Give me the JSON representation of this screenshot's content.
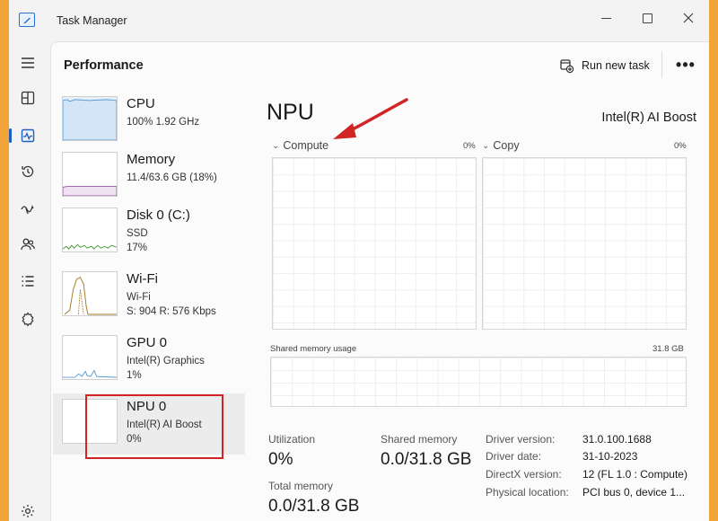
{
  "window": {
    "app_title": "Task Manager"
  },
  "nav": {
    "items": [
      {
        "name": "menu",
        "icon": "hamburger-icon"
      },
      {
        "name": "processes",
        "icon": "processes-icon"
      },
      {
        "name": "performance",
        "icon": "performance-icon",
        "active": true
      },
      {
        "name": "app-history",
        "icon": "history-icon"
      },
      {
        "name": "startup-apps",
        "icon": "startup-icon"
      },
      {
        "name": "users",
        "icon": "users-icon"
      },
      {
        "name": "details",
        "icon": "details-icon"
      },
      {
        "name": "services",
        "icon": "services-icon"
      },
      {
        "name": "settings",
        "icon": "gear-icon"
      }
    ],
    "accent": "#1b5fc5"
  },
  "header": {
    "title": "Performance",
    "run_new_task": "Run new task",
    "more": "•••"
  },
  "devices": [
    {
      "name": "CPU",
      "line2": "100%  1.92 GHz",
      "line3": ""
    },
    {
      "name": "Memory",
      "line2": "11.4/63.6 GB (18%)",
      "line3": ""
    },
    {
      "name": "Disk 0 (C:)",
      "line2": "SSD",
      "line3": "17%"
    },
    {
      "name": "Wi-Fi",
      "line2": "Wi-Fi",
      "line3": "S: 904  R: 576 Kbps"
    },
    {
      "name": "GPU 0",
      "line2": "Intel(R) Graphics",
      "line3": "1%"
    },
    {
      "name": "NPU 0",
      "line2": "Intel(R) AI Boost",
      "line3": "0%",
      "selected": true
    }
  ],
  "detail": {
    "title": "NPU",
    "subtitle": "Intel(R) AI Boost",
    "graphs": [
      {
        "label": "Compute",
        "pct": "0%"
      },
      {
        "label": "Copy",
        "pct": "0%"
      }
    ],
    "shared_memory_label": "Shared memory usage",
    "shared_memory_max": "31.8 GB",
    "stats": {
      "utilization_label": "Utilization",
      "utilization_value": "0%",
      "shared_memory_label": "Shared memory",
      "shared_memory_value": "0.0/31.8 GB",
      "total_memory_label": "Total memory",
      "total_memory_value": "0.0/31.8 GB"
    },
    "properties": [
      {
        "key": "Driver version:",
        "value": "31.0.100.1688"
      },
      {
        "key": "Driver date:",
        "value": "31-10-2023"
      },
      {
        "key": "DirectX version:",
        "value": "12 (FL 1.0 : Compute)"
      },
      {
        "key": "Physical location:",
        "value": "PCI bus 0, device 1..."
      }
    ]
  },
  "annotation": {
    "arrow_color": "#d22424",
    "highlight_color": "#d22424"
  }
}
